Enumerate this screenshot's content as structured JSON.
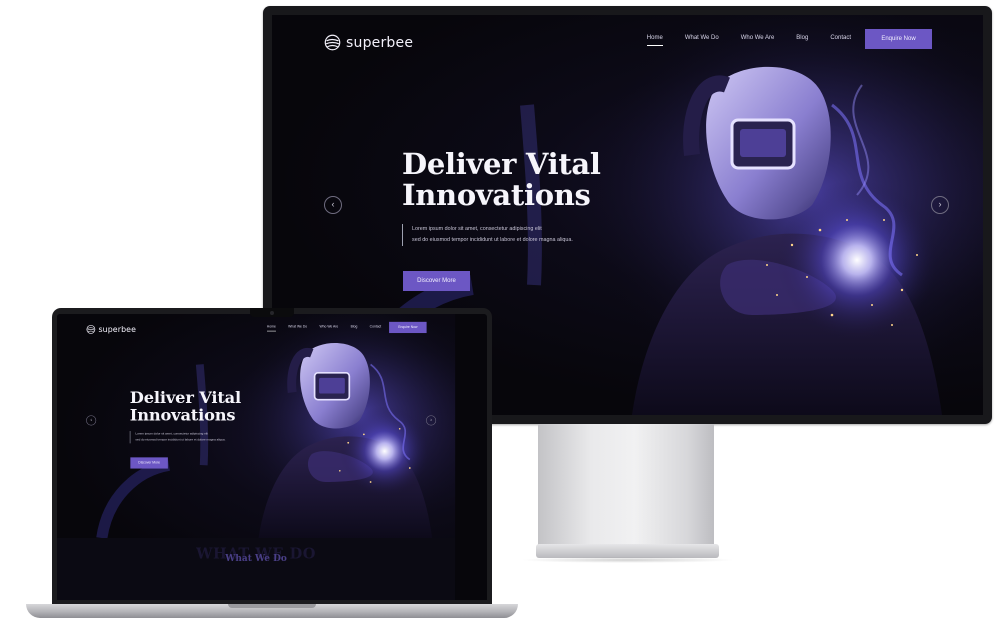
{
  "site": {
    "logo_text": "superbee",
    "nav": {
      "desktop_items": [
        {
          "label": "Home"
        },
        {
          "label": "What We Do"
        },
        {
          "label": "Who We Are"
        },
        {
          "label": "Blog"
        },
        {
          "label": "Contact"
        }
      ],
      "laptop_items": [
        {
          "label": "Home"
        },
        {
          "label": "What We Do"
        },
        {
          "label": "Who We Are"
        },
        {
          "label": "Blog"
        },
        {
          "label": "Contact"
        }
      ],
      "cta_label": "Enquire Now"
    },
    "hero": {
      "title_line1": "Deliver Vital",
      "title_line2": "Innovations",
      "text_line1": "Lorem ipsum dolor sit amet, consectetur adipiscing elit",
      "text_line2": "sed do eiusmod tempor incididunt ut labore et dolore magna aliqua.",
      "button_label": "Discover More",
      "prev_arrow": "‹",
      "next_arrow": "›"
    },
    "section": {
      "title": "What We Do",
      "ghost_title": "WHAT WE DO"
    }
  },
  "colors": {
    "accent": "#6c57c4",
    "background": "#07060b",
    "heading": "#f6f5fb",
    "section_title": "#4a3f87"
  },
  "icons": {
    "logo": "superbee-logo-icon",
    "prev": "chevron-left-icon",
    "next": "chevron-right-icon"
  }
}
